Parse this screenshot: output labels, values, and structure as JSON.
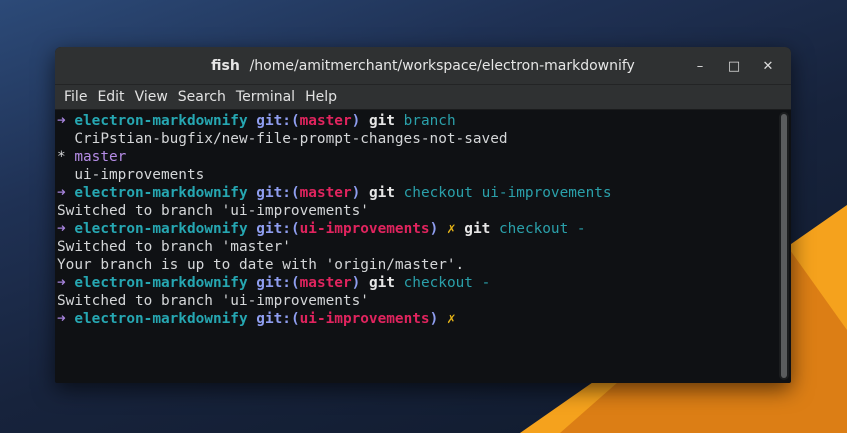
{
  "window": {
    "title_app": "fish",
    "title_path": "/home/amitmerchant/workspace/electron-markdownify",
    "controls": {
      "minimize": "–",
      "maximize": "□",
      "close": "✕"
    }
  },
  "menu": [
    "File",
    "Edit",
    "View",
    "Search",
    "Terminal",
    "Help"
  ],
  "colors": {
    "arrow": "#a482d9",
    "directory": "#26a7b2",
    "git_label": "#8f9ef0",
    "branch": "#e0245e",
    "dirty_marker": "#e6b417"
  },
  "prompt": {
    "arrow": "➜",
    "directory": "electron-markdownify",
    "git_label": "git:",
    "paren_open": "(",
    "paren_close": ")",
    "dirty": "✗"
  },
  "lines": [
    {
      "type": "prompt",
      "branch": "master",
      "dirty": false,
      "command": "git",
      "args": "branch"
    },
    {
      "type": "output",
      "text": "  CriPstian-bugfix/new-file-prompt-changes-not-saved"
    },
    {
      "type": "output-current",
      "marker": "* ",
      "text": "master"
    },
    {
      "type": "output",
      "text": "  ui-improvements"
    },
    {
      "type": "prompt",
      "branch": "master",
      "dirty": false,
      "command": "git",
      "args": "checkout ui-improvements"
    },
    {
      "type": "output",
      "text": "Switched to branch 'ui-improvements'"
    },
    {
      "type": "prompt",
      "branch": "ui-improvements",
      "dirty": true,
      "command": "git",
      "args": "checkout -"
    },
    {
      "type": "output",
      "text": "Switched to branch 'master'"
    },
    {
      "type": "output",
      "text": "Your branch is up to date with 'origin/master'."
    },
    {
      "type": "prompt",
      "branch": "master",
      "dirty": false,
      "command": "git",
      "args": "checkout -"
    },
    {
      "type": "output",
      "text": "Switched to branch 'ui-improvements'"
    },
    {
      "type": "prompt",
      "branch": "ui-improvements",
      "dirty": true,
      "command": "",
      "args": ""
    }
  ]
}
